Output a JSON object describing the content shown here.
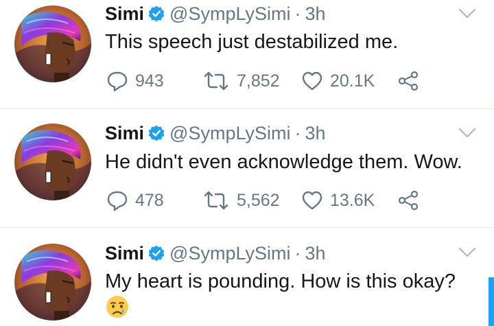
{
  "tweets": [
    {
      "name": "Simi",
      "handle": "@SympLySimi",
      "separator": "·",
      "time": "3h",
      "text": "This speech just destabilized me.",
      "replies": "943",
      "retweets": "7,852",
      "likes": "20.1K",
      "emoji": ""
    },
    {
      "name": "Simi",
      "handle": "@SympLySimi",
      "separator": "·",
      "time": "3h",
      "text": "He didn't even acknowledge them. Wow.",
      "replies": "478",
      "retweets": "5,562",
      "likes": "13.6K",
      "emoji": ""
    },
    {
      "name": "Simi",
      "handle": "@SympLySimi",
      "separator": "·",
      "time": "3h",
      "text": "My heart is pounding. How is this okay?",
      "emoji": "crying-face-emoji"
    }
  ],
  "colors": {
    "accent": "#1da1f2",
    "muted": "#657786",
    "text": "#14171a",
    "divider": "#e6ecf0"
  },
  "icons": [
    "verified-badge-icon",
    "chevron-down-icon",
    "reply-icon",
    "retweet-icon",
    "like-icon",
    "share-icon"
  ]
}
